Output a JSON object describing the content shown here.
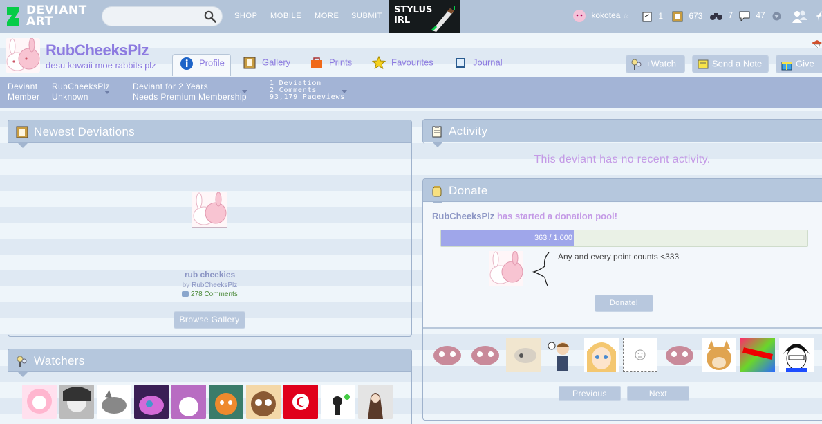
{
  "topbar": {
    "logo_line1": "DEVIANT",
    "logo_line2": "ART",
    "search_placeholder": "",
    "nav": [
      "SHOP",
      "MOBILE",
      "MORE",
      "SUBMIT"
    ],
    "promo_line1": "STYLUS",
    "promo_line2": "IRL",
    "username": "kokotea",
    "stat_deviations": "1",
    "stat_gallery": "673",
    "stat_watch": "7",
    "stat_comments": "47"
  },
  "profile": {
    "username": "RubCheeksPlz",
    "tagline": "desu kawaii moe rabbits plz",
    "tabs": [
      "Profile",
      "Gallery",
      "Prints",
      "Favourites",
      "Journal"
    ],
    "buttons": [
      "+Watch",
      "Send a Note",
      "Give"
    ]
  },
  "infobar": {
    "member_type_1": "Deviant",
    "member_type_2": "Member",
    "name": "RubCheeksPlz",
    "status": "Unknown",
    "since": "Deviant for 2 Years",
    "membership": "Needs Premium Membership",
    "deviations": "1 Deviation",
    "comments": "2 Comments",
    "pageviews": "93,179 Pageviews"
  },
  "newest": {
    "title": "Newest Deviations",
    "item_title": "rub cheekies",
    "item_by": "by",
    "item_author": "RubCheeksPlz",
    "item_comments": "278 Comments",
    "browse_label": "Browse Gallery"
  },
  "activity": {
    "title": "Activity",
    "empty_text": "This deviant has no recent activity."
  },
  "donate": {
    "title": "Donate",
    "pool_user": "RubCheeksPlz",
    "pool_text": "has started a donation pool!",
    "progress_label": "363 / 1,000",
    "progress_fraction": 0.363,
    "message": "Any and every point counts <333",
    "button": "Donate!",
    "prev": "Previous",
    "next": "Next"
  },
  "watchers": {
    "title": "Watchers"
  },
  "colors": {
    "accent": "#8d7be0",
    "topbar": "#b3c4d9",
    "infobar": "#a3b4d6",
    "progress": "#9fa6ea"
  }
}
